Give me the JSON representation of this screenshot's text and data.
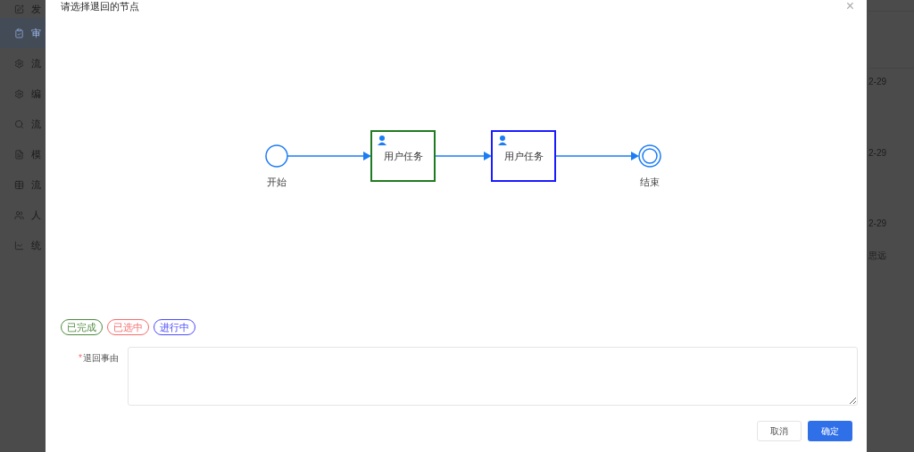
{
  "sidebar": {
    "items": [
      {
        "label": "发",
        "selected": false
      },
      {
        "label": "审",
        "selected": true
      },
      {
        "label": "流",
        "selected": false
      },
      {
        "label": "编",
        "selected": false
      },
      {
        "label": "流",
        "selected": false
      },
      {
        "label": "模",
        "selected": false
      },
      {
        "label": "流",
        "selected": false
      },
      {
        "label": "人",
        "selected": false
      },
      {
        "label": "统",
        "selected": false
      }
    ]
  },
  "background_list": {
    "cells": [
      "2-29",
      "2-29",
      "2-29",
      "思远"
    ]
  },
  "dialog": {
    "title": "请选择退回的节点",
    "close": "×",
    "diagram": {
      "nodes": [
        {
          "kind": "start",
          "label": "开始"
        },
        {
          "kind": "task",
          "label": "用户任务",
          "color": "#1f7a1f"
        },
        {
          "kind": "task",
          "label": "用户任务",
          "color": "#1a1aff"
        },
        {
          "kind": "end",
          "label": "结束"
        }
      ]
    },
    "legend": [
      {
        "label": "已完成",
        "color": "#4e8a3e"
      },
      {
        "label": "已选中",
        "color": "#f56c6c"
      },
      {
        "label": "进行中",
        "color": "#4b4bff"
      }
    ],
    "form": {
      "label": "退回事由",
      "required_mark": "*"
    },
    "buttons": [
      {
        "label": "取消",
        "kind": "default"
      },
      {
        "label": "确定",
        "kind": "primary"
      }
    ]
  }
}
